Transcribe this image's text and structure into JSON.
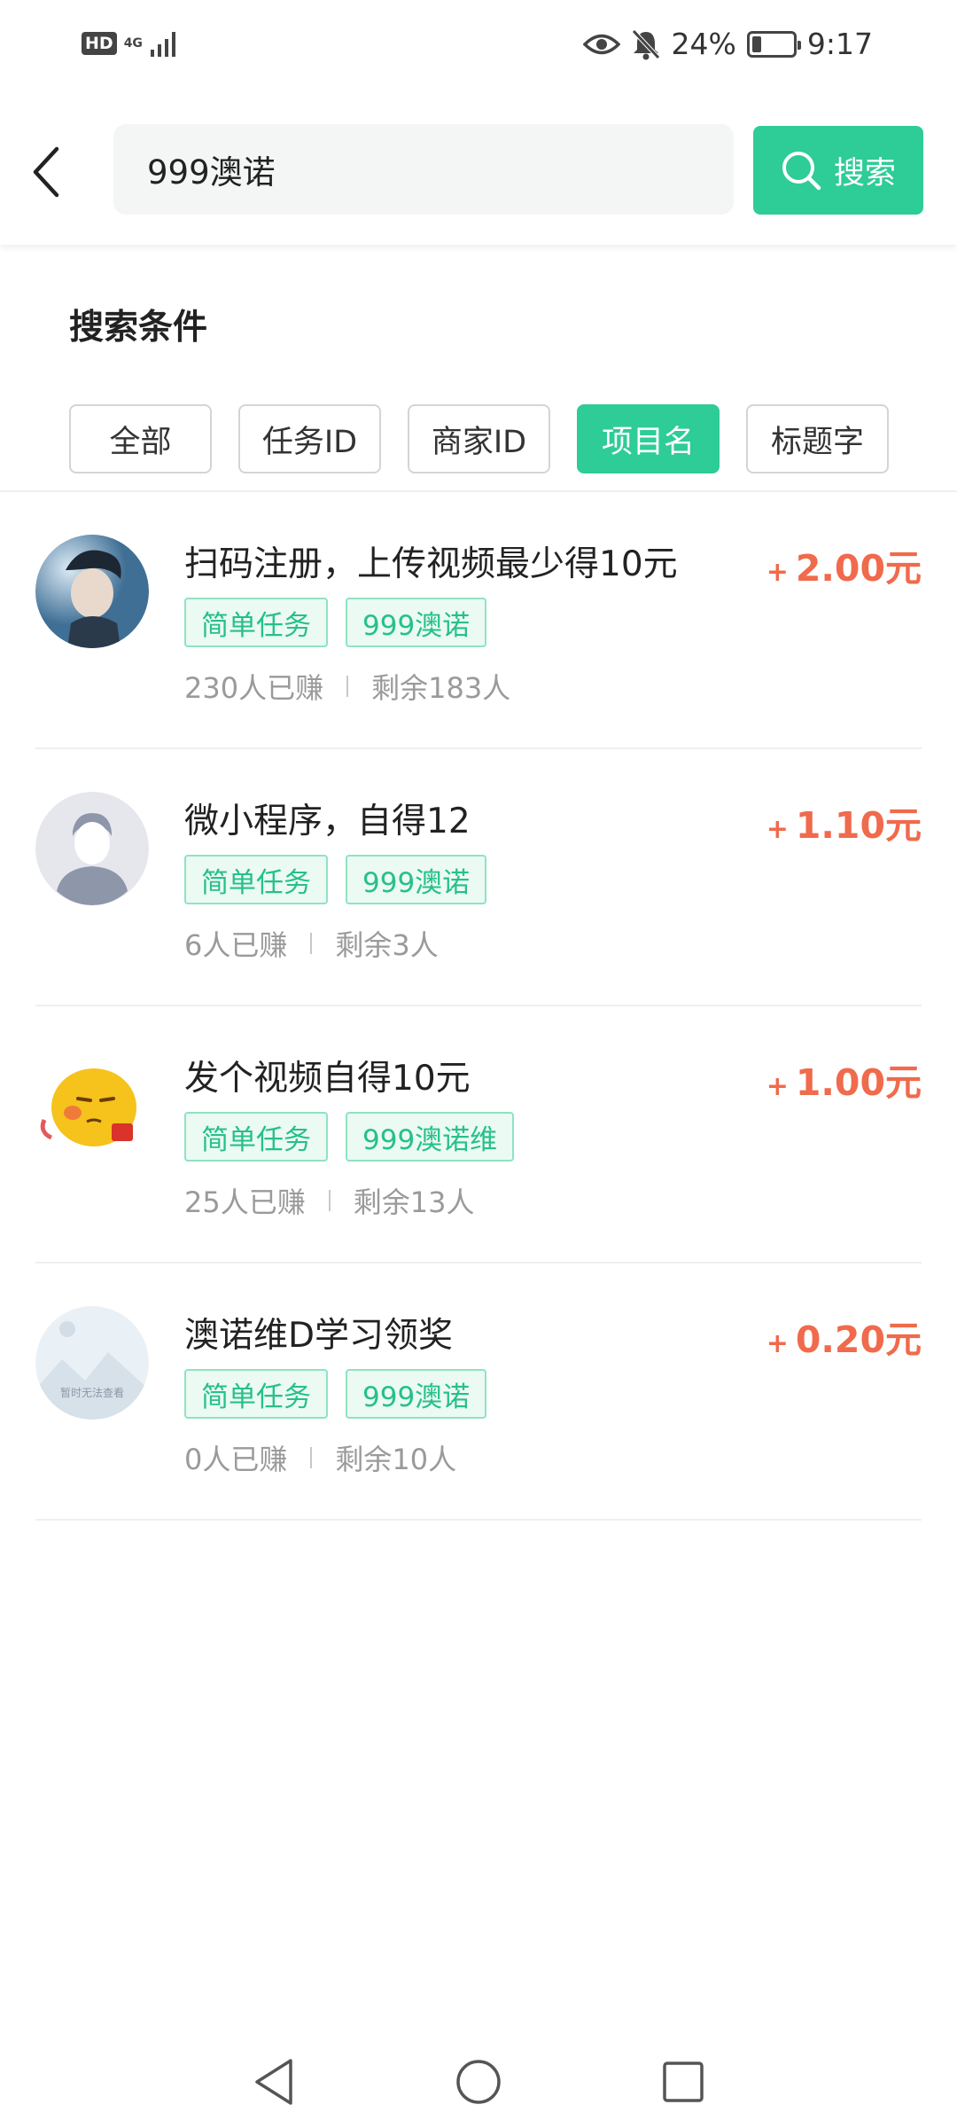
{
  "status_bar": {
    "hd_badge": "HD",
    "network": "4G",
    "battery_percent": "24%",
    "battery_level": 0.24,
    "time": "9:17"
  },
  "search": {
    "query": "999澳诺",
    "button_label": "搜索"
  },
  "filter": {
    "title": "搜索条件",
    "options": [
      "全部",
      "任务ID",
      "商家ID",
      "项目名",
      "标题字"
    ],
    "selected": "项目名"
  },
  "tasks": [
    {
      "title": "扫码注册，上传视频最少得10元",
      "tags": [
        "简单任务",
        "999澳诺"
      ],
      "earned": "230人已赚",
      "remaining": "剩余183人",
      "reward_plus": "+",
      "reward": "2.00元",
      "avatar_icon": "anime-boy-avatar"
    },
    {
      "title": "微小程序，自得12",
      "tags": [
        "简单任务",
        "999澳诺"
      ],
      "earned": "6人已赚",
      "remaining": "剩余3人",
      "reward_plus": "+",
      "reward": "1.10元",
      "avatar_icon": "default-person-avatar"
    },
    {
      "title": "发个视频自得10元",
      "tags": [
        "简单任务",
        "999澳诺维"
      ],
      "earned": "25人已赚",
      "remaining": "剩余13人",
      "reward_plus": "+",
      "reward": "1.00元",
      "avatar_icon": "yellow-cartoon-avatar"
    },
    {
      "title": "澳诺维D学习领奖",
      "tags": [
        "简单任务",
        "999澳诺"
      ],
      "earned": "0人已赚",
      "remaining": "剩余10人",
      "reward_plus": "+",
      "reward": "0.20元",
      "avatar_icon": "image-placeholder-avatar",
      "avatar_caption": "暂时无法查看"
    }
  ],
  "colors": {
    "accent": "#2ecc97",
    "reward": "#f06a4c",
    "tag_text": "#27c08b",
    "tag_bg": "#ebfaf3"
  }
}
